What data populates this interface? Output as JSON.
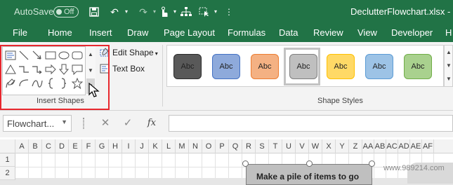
{
  "titlebar": {
    "autosave_label": "AutoSave",
    "autosave_state": "Off",
    "filename": "DeclutterFlowchart.xlsx",
    "app_suffix": "- Ex"
  },
  "tabs": [
    "File",
    "Home",
    "Insert",
    "Draw",
    "Page Layout",
    "Formulas",
    "Data",
    "Review",
    "View",
    "Developer",
    "H"
  ],
  "ribbon": {
    "edit_shape_label": "Edit Shape",
    "text_box_label": "Text Box",
    "insert_shapes_group": "Insert Shapes",
    "shape_styles_group": "Shape Styles",
    "style_swatch_label": "Abc",
    "style_colors": [
      "#595959",
      "#8eaadb",
      "#f4b183",
      "#bfbfbf",
      "#ffd966",
      "#9dc3e6",
      "#a9d18e"
    ]
  },
  "formula_bar": {
    "name_box_value": "Flowchart...",
    "cancel_symbol": "✕",
    "enter_symbol": "✓",
    "fx_label": "fx",
    "formula_value": ""
  },
  "grid": {
    "columns": [
      "A",
      "B",
      "C",
      "D",
      "E",
      "F",
      "G",
      "H",
      "I",
      "J",
      "K",
      "L",
      "M",
      "N",
      "O",
      "P",
      "Q",
      "R",
      "S",
      "T",
      "U",
      "V",
      "W",
      "X",
      "Y",
      "Z",
      "AA",
      "AB",
      "AC",
      "AD",
      "AE",
      "AF"
    ],
    "rows": [
      "1",
      "2"
    ],
    "shape_text": "Make a pile of items to go",
    "watermark": "www.989214.com"
  }
}
